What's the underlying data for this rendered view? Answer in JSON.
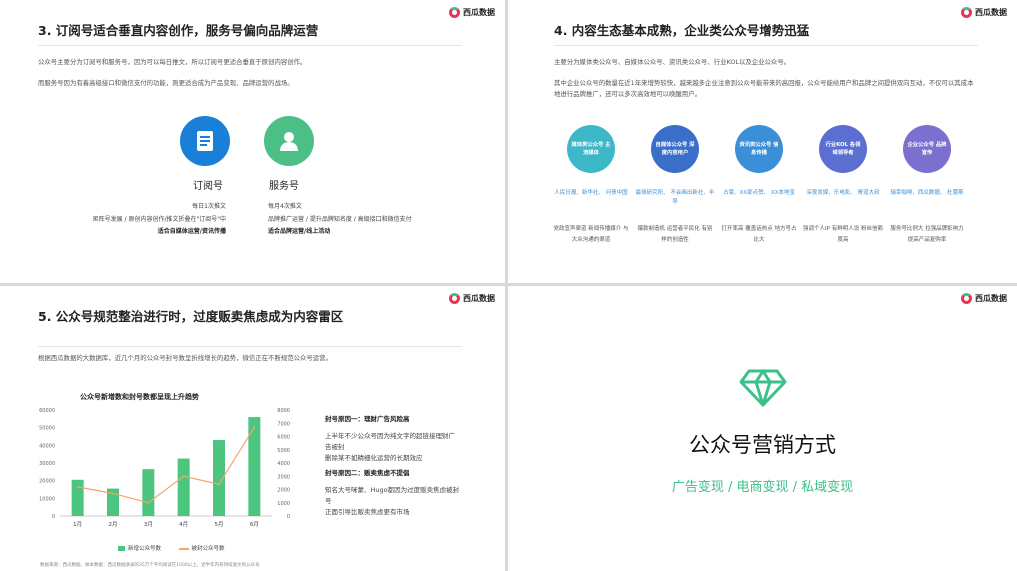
{
  "brand": {
    "name": "西瓜数据"
  },
  "slide1": {
    "title": "3. 订阅号适合垂直内容创作，服务号偏向品牌运营",
    "para1": "公众号主要分为订阅号和服务号，因为可以每日推文，所以订阅号更适合垂直于原创内容创作。",
    "para2": "而服务号因为有着高级接口和微信支付的功能，则更适合成为产品变现、品牌运营的战场。",
    "sub": {
      "name": "订阅号",
      "icon": "document-icon",
      "color": "#1a7fd6",
      "lines": [
        "每日1次推文",
        "矩阵号发展 / 原创内容创作/推文折叠在\"订阅号\"中",
        "适合自媒体运营/资讯传播"
      ]
    },
    "svc": {
      "name": "服务号",
      "icon": "person-icon",
      "color": "#4cbf86",
      "lines": [
        "每月4次推文",
        "品牌推广运营 / 提升品牌知名度 / 高级接口和微信支付",
        "适合品牌运营/线上活动"
      ]
    }
  },
  "slide2": {
    "title": "4. 内容生态基本成熟，企业类公众号增势迅猛",
    "para1": "主要分为媒体类公众号、自媒体公众号、资讯类公众号、行业KOL以及企业公众号。",
    "para2": "其中企业公众号的数量在近1年来增势较快，越来越多企业注意到公众号能带来的高回报，公众号能给用户和品牌之间提供双向互动，不仅可以其成本地进行品牌推广，还可以多次高效地可以唤醒用户。",
    "cats": [
      {
        "circle": "媒体类公众号 主流媒体",
        "color": "#3cb8c9",
        "who": "人民日报、新华社、 问债中国",
        "desc": "党政宣声渠道 新闻传播媒介 与大众沟通的渠道"
      },
      {
        "circle": "自媒体公众号 深度内容用户",
        "color": "#3a6fc9",
        "who": "最球研究所、 不会画出新社、半导",
        "desc": "爆款制造机 运营者平民化 有别样的创造性"
      },
      {
        "circle": "资讯类公众号 信息传播",
        "color": "#3a8fd8",
        "who": "占豪、XX部点赞、 XX本地宝",
        "desc": "打开率高 覆盖话热点 地方号占比大"
      },
      {
        "circle": "行业KOL 各领域领导者",
        "color": "#5a6fd1",
        "who": "深夜发媒、乐电影、 胃道大叔",
        "desc": "强调个人IP 有鲜明人设 粉丝信赖度高"
      },
      {
        "circle": "企业公众号 品牌宣传",
        "color": "#7b6fd0",
        "who": "瑞幸咖啡、西瓜数据、 杜蕾斯",
        "desc": "服务号比例大 拉强品牌影响力 提高产品复购率"
      }
    ]
  },
  "slide3": {
    "title": "5. 公众号规范整治进行时，过度贩卖焦虑成为内容雷区",
    "para1": "根据西瓜数据的大数据库，近几个月的公众号封号数呈折线增长的趋势，微信正在不断规范公众号运营。",
    "reason1_title": "封号原因一：理财广告风险高",
    "reason1_a": "上半年不少公众号因为纯文字的超链接理财广告被封",
    "reason1_b": "删除某不如精细化运营的长期效应",
    "reason2_title": "封号原因二：贩卖焦虑不提倡",
    "reason2_a": "知名大号咪蒙、Hugo都因为过度贩卖焦虑被封号",
    "reason2_b": "正面引导比贩卖焦虑更有市场",
    "footnote": "数据来源：西瓜数据，样本数据：西瓜数据收录的35万个平均阅读在1000以上，近半年内有持续发文的公众号"
  },
  "chart_data": {
    "type": "bar",
    "title": "公众号新增数和封号数都呈现上升趋势",
    "categories": [
      "1月",
      "2月",
      "3月",
      "4月",
      "5月",
      "6月"
    ],
    "series": [
      {
        "name": "新增公众号数",
        "values": [
          20500,
          15500,
          26500,
          32500,
          43000,
          56000
        ],
        "axis": "left",
        "color": "#4cc57f"
      },
      {
        "name": "被封公众号数",
        "values": [
          2200,
          1700,
          1000,
          3000,
          2400,
          6700
        ],
        "axis": "right",
        "color": "#f4a56a",
        "kind": "line"
      }
    ],
    "ylim_left": [
      0,
      60000
    ],
    "ylim_right": [
      0,
      8000
    ],
    "yticks_left": [
      "60000",
      "50000",
      "40000",
      "30000",
      "20000",
      "10000",
      "0"
    ],
    "yticks_right": [
      "8000",
      "7000",
      "6000",
      "5000",
      "4000",
      "3000",
      "2000",
      "1000",
      "0"
    ],
    "legend": "bottom",
    "grid": false
  },
  "slide4": {
    "icon": "diamond-icon",
    "title": "公众号营销方式",
    "subtitle": "广告变现 / 电商变现 / 私域变现",
    "accent": "#3cc08a"
  }
}
